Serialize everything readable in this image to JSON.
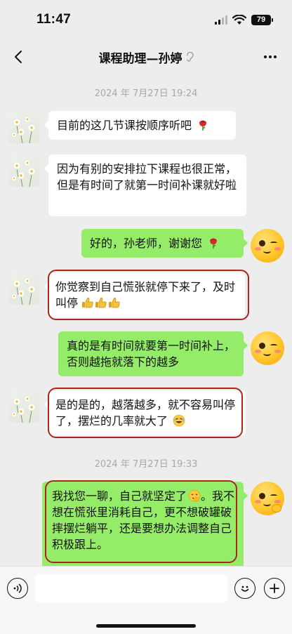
{
  "status_bar": {
    "time": "11:47",
    "battery": "79"
  },
  "header": {
    "title": "课程助理—孙婷"
  },
  "chat": {
    "timestamps": [
      "2024 年 7月27日 19:24",
      "2024 年 7月27日 19:33"
    ],
    "messages": [
      {
        "from": "them",
        "text": "目前的这几节课按顺序听吧",
        "emoji": "rose"
      },
      {
        "from": "them",
        "text": "因为有别的安排拉下课程也很正常，但是有时间了就第一时间补课就好啦"
      },
      {
        "from": "me",
        "text": "好的，孙老师，谢谢您",
        "emoji": "rose"
      },
      {
        "from": "them",
        "text": "你觉察到自己慌张就停下来了，及时叫停",
        "emoji": "thumbs-up x3",
        "highlighted": true
      },
      {
        "from": "me",
        "text": "真的是有时间就要第一时间补上，否则越拖就落下的越多"
      },
      {
        "from": "them",
        "text": "是的是的，越落越多，就不容易叫停了，摆烂的几率就大了",
        "emoji": "laughing",
        "highlighted": true
      },
      {
        "from": "me",
        "text": "我找您一聊，自己就坚定了",
        "text_after_emoji": "。我不想在慌张里消耗自己，更不想破罐破摔摆烂躺平，还是要想办法调整自己积极跟上。",
        "emoji": "shy-smile",
        "highlighted": true
      }
    ]
  },
  "icons": [
    "back-icon",
    "ear-icon",
    "more-icon",
    "voice-icon",
    "emoji-icon",
    "plus-icon",
    "signal-icon",
    "wifi-icon",
    "battery-icon"
  ],
  "colors": {
    "background": "#ededed",
    "outgoing_bubble": "#95ec69",
    "incoming_bubble": "#ffffff",
    "highlight_ring": "#a8261c"
  }
}
